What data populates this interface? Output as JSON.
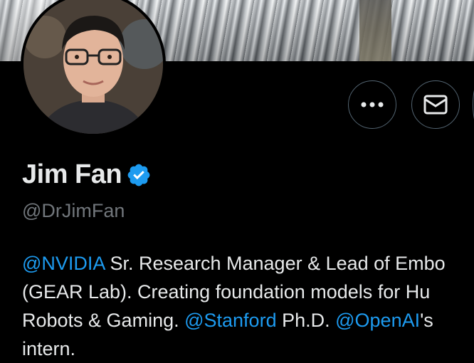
{
  "profile": {
    "display_name": "Jim Fan",
    "handle": "@DrJimFan",
    "verified_icon": "verified-badge-icon",
    "avatar_icon": "profile-photo",
    "banner_icon": "banner-image"
  },
  "actions": [
    {
      "name": "more-options",
      "icon": "ellipsis-icon"
    },
    {
      "name": "message",
      "icon": "envelope-icon"
    }
  ],
  "bio": {
    "line1": {
      "mention1": "@NVIDIA",
      "text1": " Sr. Research Manager & Lead of Embo"
    },
    "line2": {
      "text": "(GEAR Lab). Creating foundation models for Hu"
    },
    "line3": {
      "text1": "Robots & Gaming. ",
      "mention1": "@Stanford",
      "text2": " Ph.D. ",
      "mention2": "@OpenAI",
      "text3": "'s"
    },
    "line4": {
      "text": "intern."
    }
  },
  "colors": {
    "background": "#000000",
    "text_primary": "#e7e9ea",
    "text_secondary": "#71767b",
    "link": "#1d9bf0",
    "button_border": "#536471",
    "verified": "#1d9bf0"
  }
}
